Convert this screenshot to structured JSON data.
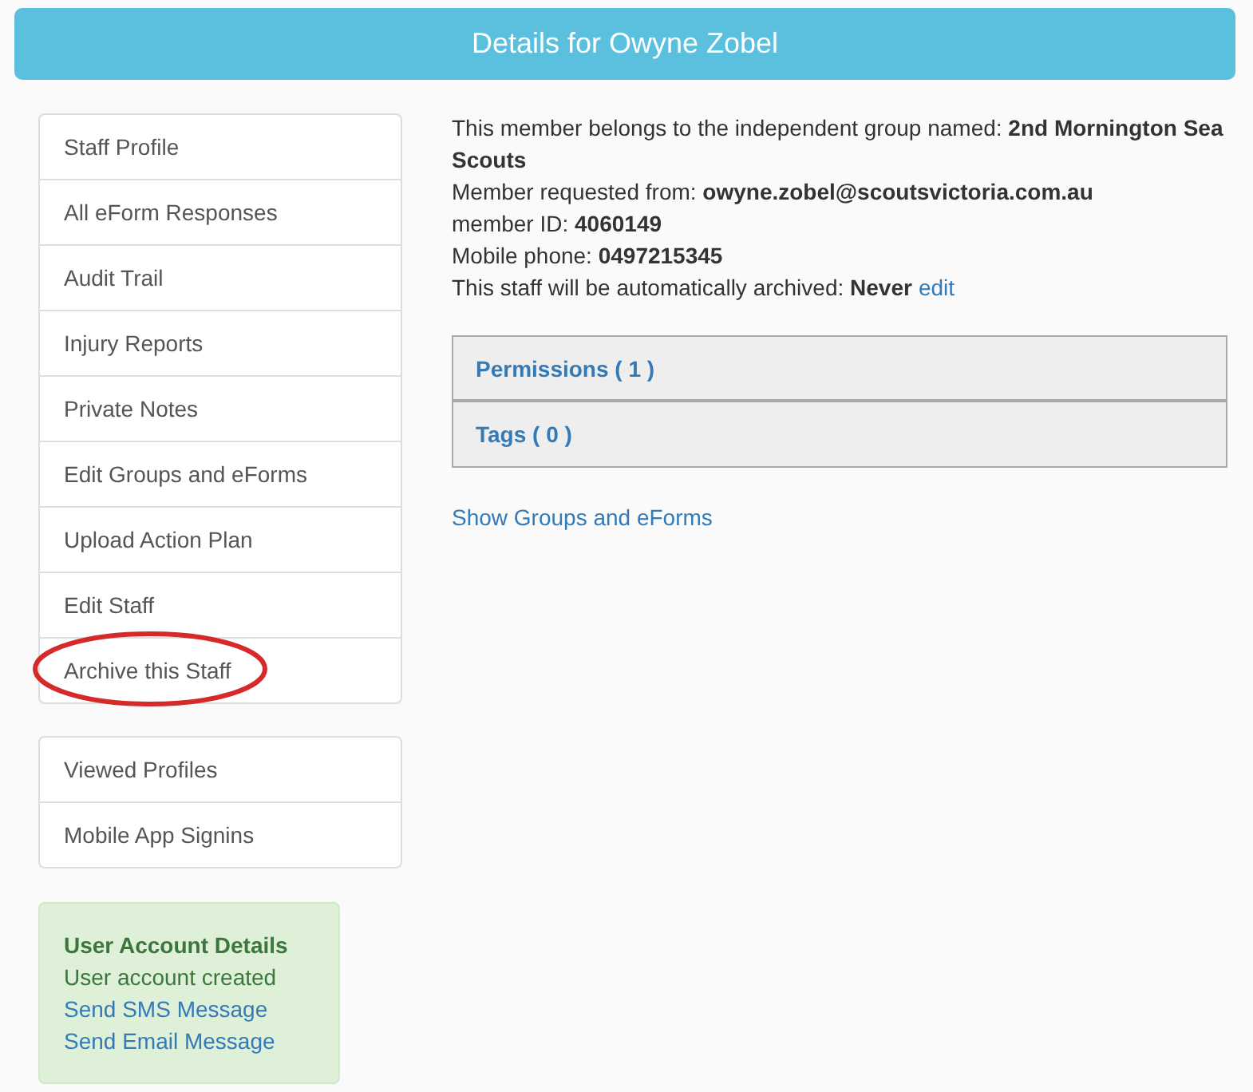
{
  "header": {
    "title": "Details for Owyne Zobel"
  },
  "sidebar": {
    "menus": [
      [
        {
          "label": "Staff Profile",
          "highlighted": false
        },
        {
          "label": "All eForm Responses",
          "highlighted": false
        },
        {
          "label": "Audit Trail",
          "highlighted": false
        },
        {
          "label": "Injury Reports",
          "highlighted": false
        },
        {
          "label": "Private Notes",
          "highlighted": false
        },
        {
          "label": "Edit Groups and eForms",
          "highlighted": false
        },
        {
          "label": "Upload Action Plan",
          "highlighted": false
        },
        {
          "label": "Edit Staff",
          "highlighted": false
        },
        {
          "label": "Archive this Staff",
          "highlighted": true
        }
      ],
      [
        {
          "label": "Viewed Profiles",
          "highlighted": false
        },
        {
          "label": "Mobile App Signins",
          "highlighted": false
        }
      ]
    ],
    "account_box": {
      "title": "User Account Details",
      "status": "User account created",
      "links": [
        "Send SMS Message",
        "Send Email Message"
      ]
    }
  },
  "details": {
    "lines": [
      {
        "text": "This member belongs to the independent group named: **2nd Mornington Sea Scouts**"
      },
      {
        "text": "Member requested from: **owyne.zobel@scoutsvictoria.com.au**"
      },
      {
        "text": "member ID: **4060149**"
      },
      {
        "text": "Mobile phone: **0497215345**"
      },
      {
        "text": "This staff will be automatically archived: **Never**",
        "link": "edit"
      }
    ],
    "panels": [
      {
        "title": "Permissions ( 1 )"
      },
      {
        "title": "Tags ( 0 )"
      }
    ],
    "link": "Show Groups and eForms"
  }
}
